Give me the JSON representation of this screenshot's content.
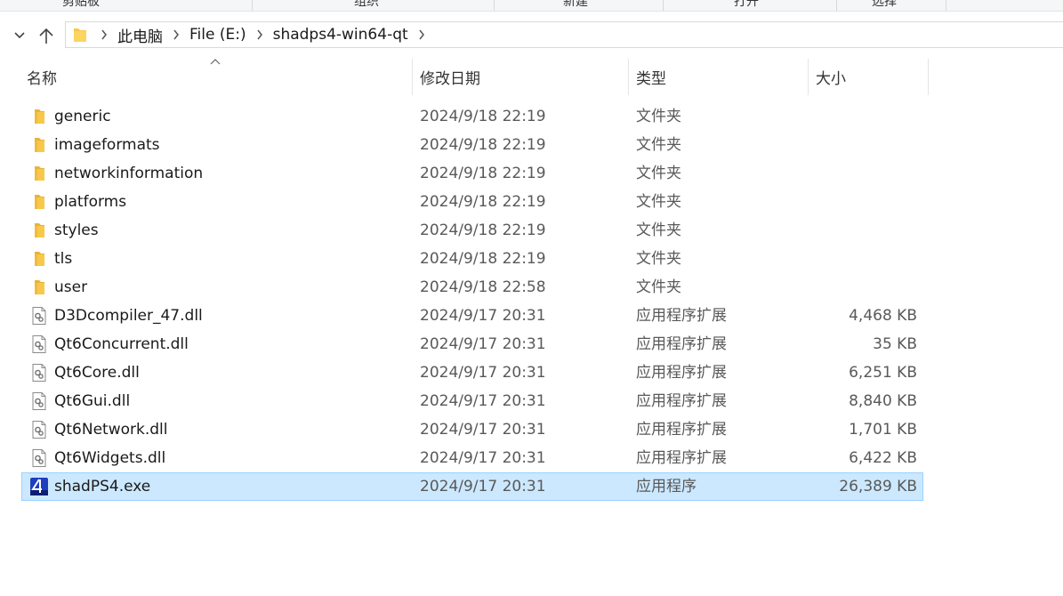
{
  "ribbon": {
    "groups": [
      "剪贴板",
      "组织",
      "新建",
      "打开",
      "选择"
    ]
  },
  "breadcrumb": {
    "items": [
      "此电脑",
      "File (E:)",
      "shadps4-win64-qt"
    ]
  },
  "columns": {
    "name": "名称",
    "date": "修改日期",
    "type": "类型",
    "size": "大小"
  },
  "rows": [
    {
      "name": "generic",
      "date": "2024/9/18 22:19",
      "type": "文件夹",
      "size": "",
      "icon": "folder-icon"
    },
    {
      "name": "imageformats",
      "date": "2024/9/18 22:19",
      "type": "文件夹",
      "size": "",
      "icon": "folder-icon"
    },
    {
      "name": "networkinformation",
      "date": "2024/9/18 22:19",
      "type": "文件夹",
      "size": "",
      "icon": "folder-icon"
    },
    {
      "name": "platforms",
      "date": "2024/9/18 22:19",
      "type": "文件夹",
      "size": "",
      "icon": "folder-icon"
    },
    {
      "name": "styles",
      "date": "2024/9/18 22:19",
      "type": "文件夹",
      "size": "",
      "icon": "folder-icon"
    },
    {
      "name": "tls",
      "date": "2024/9/18 22:19",
      "type": "文件夹",
      "size": "",
      "icon": "folder-icon"
    },
    {
      "name": "user",
      "date": "2024/9/18 22:58",
      "type": "文件夹",
      "size": "",
      "icon": "folder-icon"
    },
    {
      "name": "D3Dcompiler_47.dll",
      "date": "2024/9/17 20:31",
      "type": "应用程序扩展",
      "size": "4,468 KB",
      "icon": "dll-file-icon"
    },
    {
      "name": "Qt6Concurrent.dll",
      "date": "2024/9/17 20:31",
      "type": "应用程序扩展",
      "size": "35 KB",
      "icon": "dll-file-icon"
    },
    {
      "name": "Qt6Core.dll",
      "date": "2024/9/17 20:31",
      "type": "应用程序扩展",
      "size": "6,251 KB",
      "icon": "dll-file-icon"
    },
    {
      "name": "Qt6Gui.dll",
      "date": "2024/9/17 20:31",
      "type": "应用程序扩展",
      "size": "8,840 KB",
      "icon": "dll-file-icon"
    },
    {
      "name": "Qt6Network.dll",
      "date": "2024/9/17 20:31",
      "type": "应用程序扩展",
      "size": "1,701 KB",
      "icon": "dll-file-icon"
    },
    {
      "name": "Qt6Widgets.dll",
      "date": "2024/9/17 20:31",
      "type": "应用程序扩展",
      "size": "6,422 KB",
      "icon": "dll-file-icon"
    },
    {
      "name": "shadPS4.exe",
      "date": "2024/9/17 20:31",
      "type": "应用程序",
      "size": "26,389 KB",
      "icon": "shadps4-app-icon",
      "selected": true
    }
  ],
  "colors": {
    "selection_bg": "#cce8ff",
    "selection_border": "#99d1ff",
    "folder": "#f8c84a"
  }
}
